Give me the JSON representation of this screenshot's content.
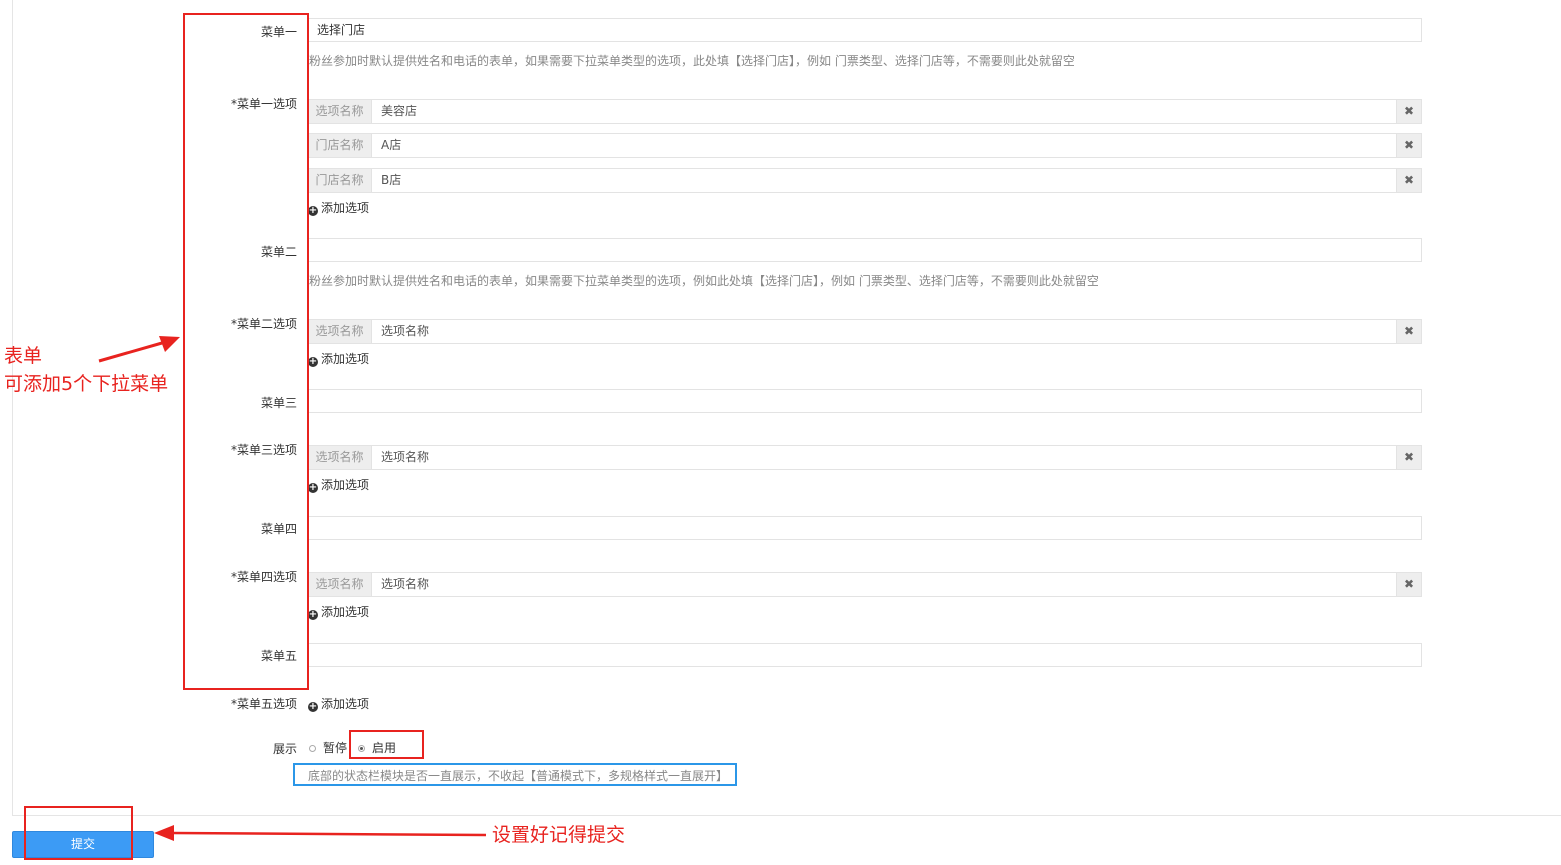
{
  "menus": {
    "menu1": {
      "label": "菜单一",
      "value": "选择门店",
      "hint": "粉丝参加时默认提供姓名和电话的表单，如果需要下拉菜单类型的选项，此处填【选择门店】，例如 门票类型、选择门店等，不需要则此处就留空",
      "options_label": "*菜单一选项",
      "options": [
        {
          "addon": "选项名称",
          "value": "美容店"
        },
        {
          "addon": "门店名称",
          "value": "A店"
        },
        {
          "addon": "门店名称",
          "value": "B店"
        }
      ]
    },
    "menu2": {
      "label": "菜单二",
      "value": "",
      "hint": "粉丝参加时默认提供姓名和电话的表单，如果需要下拉菜单类型的选项，例如此处填【选择门店】，例如 门票类型、选择门店等，不需要则此处就留空",
      "options_label": "*菜单二选项",
      "options": [
        {
          "addon": "选项名称",
          "value": "选项名称"
        }
      ]
    },
    "menu3": {
      "label": "菜单三",
      "value": "",
      "options_label": "*菜单三选项",
      "options": [
        {
          "addon": "选项名称",
          "value": "选项名称"
        }
      ]
    },
    "menu4": {
      "label": "菜单四",
      "value": "",
      "options_label": "*菜单四选项",
      "options": [
        {
          "addon": "选项名称",
          "value": "选项名称"
        }
      ]
    },
    "menu5": {
      "label": "菜单五",
      "value": "",
      "options_label": "*菜单五选项"
    }
  },
  "remove_icon": "times-icon",
  "add_option_label": "添加选项",
  "display": {
    "label": "展示",
    "options": [
      {
        "label": "暂停",
        "checked": false
      },
      {
        "label": "启用",
        "checked": true
      }
    ],
    "hint": "底部的状态栏模块是否一直展示，不收起【普通模式下，多规格样式一直展开】"
  },
  "submit_label": "提交",
  "annotations": {
    "form_title": "表单",
    "form_desc": "可添加5个下拉菜单",
    "submit_note": "设置好记得提交"
  },
  "colors": {
    "annotation_red": "#e8231f",
    "annotation_blue": "#2b97e8",
    "submit_blue": "#3c9bf5"
  }
}
